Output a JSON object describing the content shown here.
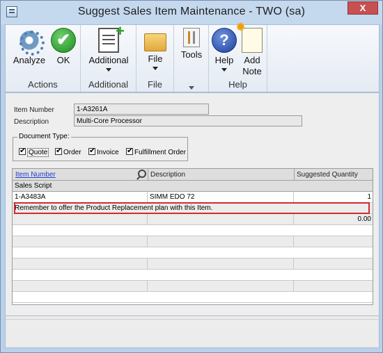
{
  "window": {
    "title": "Suggest Sales Item Maintenance  -  TWO (sa)",
    "close_glyph": "X"
  },
  "ribbon": {
    "groups": [
      {
        "label": "Actions",
        "buttons": [
          {
            "label": "Analyze",
            "icon": "gear-icon"
          },
          {
            "label": "OK",
            "icon": "checkmark-icon",
            "glyph": "✔"
          }
        ]
      },
      {
        "label": "Additional",
        "buttons": [
          {
            "label": "Additional",
            "icon": "additional-icon"
          }
        ]
      },
      {
        "label": "File",
        "buttons": [
          {
            "label": "File",
            "icon": "folder-icon"
          }
        ]
      },
      {
        "label": "",
        "buttons": [
          {
            "label": "Tools",
            "icon": "tools-icon"
          }
        ]
      },
      {
        "label": "Help",
        "buttons": [
          {
            "label": "Help",
            "icon": "help-icon",
            "glyph": "?"
          },
          {
            "label": "Add\nNote",
            "icon": "note-icon"
          }
        ]
      }
    ]
  },
  "form": {
    "item_number_label": "Item Number",
    "item_number_value": "1-A3261A",
    "description_label": "Description",
    "description_value": "Multi-Core Processor",
    "document_type": {
      "legend": "Document Type:",
      "options": [
        {
          "label": "Quote",
          "checked": true
        },
        {
          "label": "Order",
          "checked": true
        },
        {
          "label": "Invoice",
          "checked": true
        },
        {
          "label": "Fulfillment Order",
          "checked": true
        }
      ]
    }
  },
  "grid": {
    "headers": {
      "item_number": "Item Number",
      "description": "Description",
      "suggested_quantity": "Suggested Quantity"
    },
    "sales_script_header": "Sales Script",
    "rows": [
      {
        "item_number": "1-A3483A",
        "description": "SIMM EDO 72",
        "quantity": "1",
        "script": "Remember to offer the Product Replacement plan with this Item."
      },
      {
        "item_number": "",
        "description": "",
        "quantity": "0.00"
      }
    ],
    "highlight_color": "#d22b2b"
  }
}
